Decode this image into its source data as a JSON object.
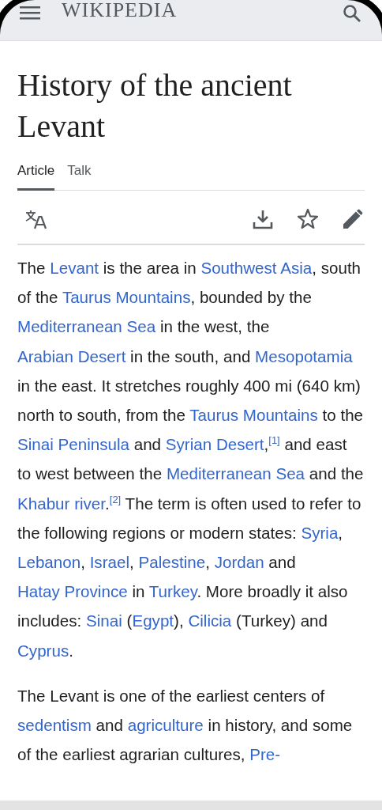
{
  "header": {
    "logo": "WIKIPEDIA"
  },
  "title": "History of the ancient Levant",
  "tabs": [
    {
      "label": "Article",
      "selected": true
    },
    {
      "label": "Talk",
      "selected": false
    }
  ],
  "paragraphs": [
    [
      {
        "kind": "text",
        "text": "The "
      },
      {
        "kind": "link",
        "text": "Levant"
      },
      {
        "kind": "text",
        "text": " is the area in "
      },
      {
        "kind": "link",
        "text": "Southwest Asia"
      },
      {
        "kind": "text",
        "text": ", south of the "
      },
      {
        "kind": "link",
        "text": "Taurus Mountains"
      },
      {
        "kind": "text",
        "text": ", bounded by the "
      },
      {
        "kind": "link",
        "text": "Mediterranean Sea"
      },
      {
        "kind": "text",
        "text": " in the west, the "
      },
      {
        "kind": "link",
        "text": "Arabian Desert"
      },
      {
        "kind": "text",
        "text": " in the south, and "
      },
      {
        "kind": "link",
        "text": "Mesopotamia"
      },
      {
        "kind": "text",
        "text": " in the east. It stretches roughly 400 mi (640 km) north to south, from the "
      },
      {
        "kind": "link",
        "text": "Taurus Mountains"
      },
      {
        "kind": "text",
        "text": " to the "
      },
      {
        "kind": "link",
        "text": "Sinai Peninsula"
      },
      {
        "kind": "text",
        "text": " and "
      },
      {
        "kind": "link",
        "text": "Syrian Desert"
      },
      {
        "kind": "text",
        "text": ","
      },
      {
        "kind": "ref",
        "text": "[1]"
      },
      {
        "kind": "text",
        "text": " and east to west between the "
      },
      {
        "kind": "link",
        "text": "Mediterranean Sea"
      },
      {
        "kind": "text",
        "text": " and the "
      },
      {
        "kind": "link",
        "text": "Khabur river"
      },
      {
        "kind": "text",
        "text": "."
      },
      {
        "kind": "ref",
        "text": "[2]"
      },
      {
        "kind": "text",
        "text": " The term is often used to refer to the following regions or modern states: "
      },
      {
        "kind": "link",
        "text": "Syria"
      },
      {
        "kind": "text",
        "text": ", "
      },
      {
        "kind": "link",
        "text": "Lebanon"
      },
      {
        "kind": "text",
        "text": ", "
      },
      {
        "kind": "link",
        "text": "Israel"
      },
      {
        "kind": "text",
        "text": ", "
      },
      {
        "kind": "link",
        "text": "Palestine"
      },
      {
        "kind": "text",
        "text": ", "
      },
      {
        "kind": "link",
        "text": "Jordan"
      },
      {
        "kind": "text",
        "text": " and "
      },
      {
        "kind": "link",
        "text": "Hatay Province"
      },
      {
        "kind": "text",
        "text": " in "
      },
      {
        "kind": "link",
        "text": "Turkey"
      },
      {
        "kind": "text",
        "text": ". More broadly it also includes: "
      },
      {
        "kind": "link",
        "text": "Sinai"
      },
      {
        "kind": "text",
        "text": " ("
      },
      {
        "kind": "link",
        "text": "Egypt"
      },
      {
        "kind": "text",
        "text": "), "
      },
      {
        "kind": "link",
        "text": "Cilicia"
      },
      {
        "kind": "text",
        "text": " (Turkey) and "
      },
      {
        "kind": "link",
        "text": "Cyprus"
      },
      {
        "kind": "text",
        "text": "."
      }
    ],
    [
      {
        "kind": "text",
        "text": "The Levant is one of the earliest centers of "
      },
      {
        "kind": "link",
        "text": "sedentism"
      },
      {
        "kind": "text",
        "text": " and "
      },
      {
        "kind": "link",
        "text": "agriculture"
      },
      {
        "kind": "text",
        "text": " in history, and some of the earliest agrarian cultures, "
      },
      {
        "kind": "link",
        "text": "Pre-"
      }
    ]
  ]
}
